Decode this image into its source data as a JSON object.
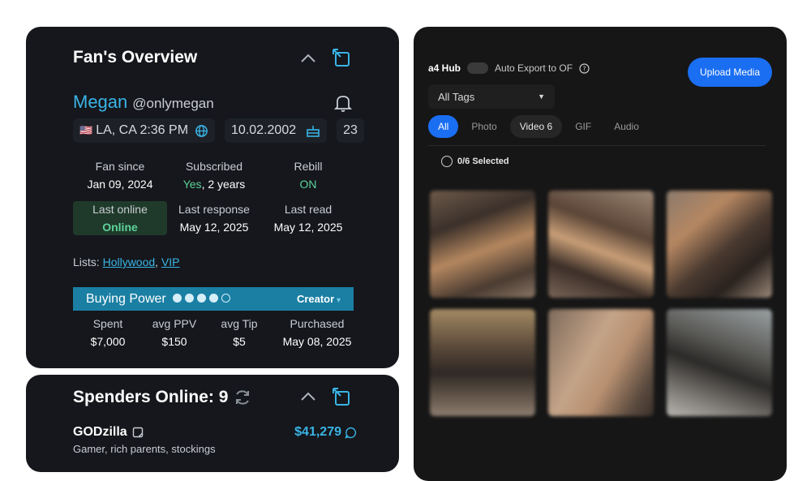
{
  "overview": {
    "title": "Fan's Overview",
    "fan_name": "Megan",
    "fan_handle": "@onlymegan",
    "flag": "🇺🇸",
    "location_time": "LA, CA 2:36 PM",
    "birthday": "10.02.2002",
    "age": "23",
    "stats_row1": [
      {
        "label": "Fan since",
        "value": "Jan 09, 2024"
      },
      {
        "label": "Subscribed",
        "value_highlight": "Yes",
        "value_rest": ", 2 years"
      },
      {
        "label": "Rebill",
        "value": "ON"
      }
    ],
    "stats_row2": [
      {
        "label": "Last online",
        "value": "Online"
      },
      {
        "label": "Last response",
        "value": "May 12, 2025"
      },
      {
        "label": "Last read",
        "value": "May 12, 2025"
      }
    ],
    "lists_label": "Lists:",
    "lists": [
      "Hollywood",
      "VIP"
    ],
    "buying_power": {
      "label": "Buying Power",
      "level": 4,
      "max": 5,
      "tier": "Creator"
    },
    "spend_stats": [
      {
        "label": "Spent",
        "value": "$7,000"
      },
      {
        "label": "avg PPV",
        "value": "$150"
      },
      {
        "label": "avg Tip",
        "value": "$5"
      },
      {
        "label": "Purchased",
        "value": "May 08, 2025"
      }
    ]
  },
  "spenders": {
    "title": "Spenders Online: 9",
    "items": [
      {
        "name": "GODzilla",
        "amount": "$41,279",
        "tags": "Gamer, rich parents, stockings"
      }
    ]
  },
  "hub": {
    "title": "a4 Hub",
    "auto_export_label": "Auto Export to OF",
    "upload_label": "Upload Media",
    "tags_select": "All Tags",
    "tabs": [
      "All",
      "Photo",
      "Video 6",
      "GIF",
      "Audio"
    ],
    "active_tab": "All",
    "selected_count": "0/6 Selected",
    "media_count": 6
  },
  "colors": {
    "accent": "#3ab4e6",
    "online_green": "#5dd39a",
    "upload_blue": "#1a6ef2",
    "panel_bg": "#15171c"
  }
}
